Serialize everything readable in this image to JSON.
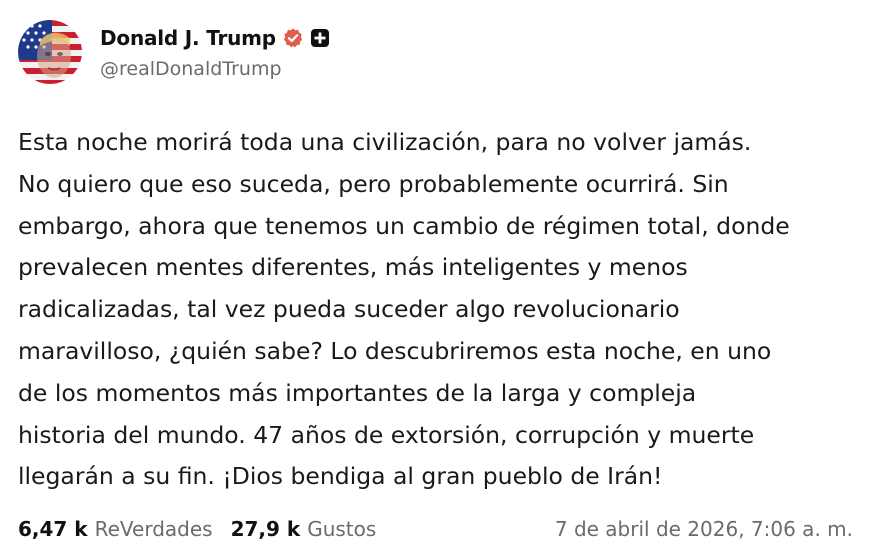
{
  "author": {
    "display_name": "Donald J. Trump",
    "handle": "@realDonaldTrump",
    "verified_icon": "verified-badge-icon",
    "verified_color": "#e25d4b",
    "plus_icon": "plus-badge-icon"
  },
  "post": {
    "lines": [
      "Esta noche morirá toda una civilización, para no volver jamás.",
      "No quiero que eso suceda, pero probablemente ocurrirá. Sin",
      "embargo, ahora que tenemos un cambio de régimen total, donde",
      "prevalecen mentes diferentes, más inteligentes y menos",
      "radicalizadas, tal vez pueda suceder algo revolucionario",
      "maravilloso, ¿quién sabe? Lo descubriremos esta noche, en uno",
      "de los momentos más importantes de la larga y compleja",
      "historia del mundo. 47 años de extorsión, corrupción y muerte",
      "llegarán a su fin. ¡Dios bendiga al gran pueblo de Irán!"
    ]
  },
  "stats": {
    "reposts_value": "6,47 k",
    "reposts_label": "ReVerdades",
    "likes_value": "27,9 k",
    "likes_label": "Gustos",
    "timestamp": "7 de abril de 2026, 7:06 a. m."
  }
}
